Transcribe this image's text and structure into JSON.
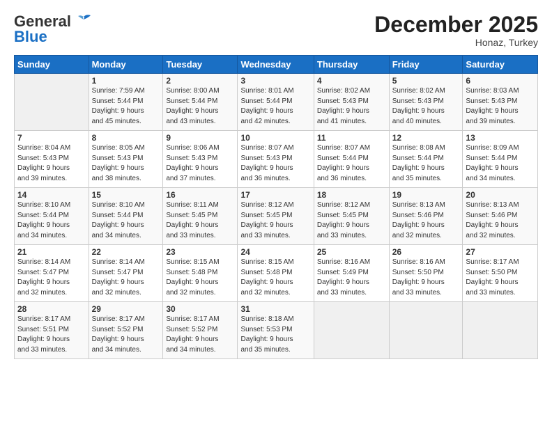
{
  "header": {
    "logo_general": "General",
    "logo_blue": "Blue",
    "month_title": "December 2025",
    "location": "Honaz, Turkey"
  },
  "weekdays": [
    "Sunday",
    "Monday",
    "Tuesday",
    "Wednesday",
    "Thursday",
    "Friday",
    "Saturday"
  ],
  "weeks": [
    [
      {
        "day": "",
        "info": ""
      },
      {
        "day": "1",
        "info": "Sunrise: 7:59 AM\nSunset: 5:44 PM\nDaylight: 9 hours\nand 45 minutes."
      },
      {
        "day": "2",
        "info": "Sunrise: 8:00 AM\nSunset: 5:44 PM\nDaylight: 9 hours\nand 43 minutes."
      },
      {
        "day": "3",
        "info": "Sunrise: 8:01 AM\nSunset: 5:44 PM\nDaylight: 9 hours\nand 42 minutes."
      },
      {
        "day": "4",
        "info": "Sunrise: 8:02 AM\nSunset: 5:43 PM\nDaylight: 9 hours\nand 41 minutes."
      },
      {
        "day": "5",
        "info": "Sunrise: 8:02 AM\nSunset: 5:43 PM\nDaylight: 9 hours\nand 40 minutes."
      },
      {
        "day": "6",
        "info": "Sunrise: 8:03 AM\nSunset: 5:43 PM\nDaylight: 9 hours\nand 39 minutes."
      }
    ],
    [
      {
        "day": "7",
        "info": "Sunrise: 8:04 AM\nSunset: 5:43 PM\nDaylight: 9 hours\nand 39 minutes."
      },
      {
        "day": "8",
        "info": "Sunrise: 8:05 AM\nSunset: 5:43 PM\nDaylight: 9 hours\nand 38 minutes."
      },
      {
        "day": "9",
        "info": "Sunrise: 8:06 AM\nSunset: 5:43 PM\nDaylight: 9 hours\nand 37 minutes."
      },
      {
        "day": "10",
        "info": "Sunrise: 8:07 AM\nSunset: 5:43 PM\nDaylight: 9 hours\nand 36 minutes."
      },
      {
        "day": "11",
        "info": "Sunrise: 8:07 AM\nSunset: 5:44 PM\nDaylight: 9 hours\nand 36 minutes."
      },
      {
        "day": "12",
        "info": "Sunrise: 8:08 AM\nSunset: 5:44 PM\nDaylight: 9 hours\nand 35 minutes."
      },
      {
        "day": "13",
        "info": "Sunrise: 8:09 AM\nSunset: 5:44 PM\nDaylight: 9 hours\nand 34 minutes."
      }
    ],
    [
      {
        "day": "14",
        "info": "Sunrise: 8:10 AM\nSunset: 5:44 PM\nDaylight: 9 hours\nand 34 minutes."
      },
      {
        "day": "15",
        "info": "Sunrise: 8:10 AM\nSunset: 5:44 PM\nDaylight: 9 hours\nand 34 minutes."
      },
      {
        "day": "16",
        "info": "Sunrise: 8:11 AM\nSunset: 5:45 PM\nDaylight: 9 hours\nand 33 minutes."
      },
      {
        "day": "17",
        "info": "Sunrise: 8:12 AM\nSunset: 5:45 PM\nDaylight: 9 hours\nand 33 minutes."
      },
      {
        "day": "18",
        "info": "Sunrise: 8:12 AM\nSunset: 5:45 PM\nDaylight: 9 hours\nand 33 minutes."
      },
      {
        "day": "19",
        "info": "Sunrise: 8:13 AM\nSunset: 5:46 PM\nDaylight: 9 hours\nand 32 minutes."
      },
      {
        "day": "20",
        "info": "Sunrise: 8:13 AM\nSunset: 5:46 PM\nDaylight: 9 hours\nand 32 minutes."
      }
    ],
    [
      {
        "day": "21",
        "info": "Sunrise: 8:14 AM\nSunset: 5:47 PM\nDaylight: 9 hours\nand 32 minutes."
      },
      {
        "day": "22",
        "info": "Sunrise: 8:14 AM\nSunset: 5:47 PM\nDaylight: 9 hours\nand 32 minutes."
      },
      {
        "day": "23",
        "info": "Sunrise: 8:15 AM\nSunset: 5:48 PM\nDaylight: 9 hours\nand 32 minutes."
      },
      {
        "day": "24",
        "info": "Sunrise: 8:15 AM\nSunset: 5:48 PM\nDaylight: 9 hours\nand 32 minutes."
      },
      {
        "day": "25",
        "info": "Sunrise: 8:16 AM\nSunset: 5:49 PM\nDaylight: 9 hours\nand 33 minutes."
      },
      {
        "day": "26",
        "info": "Sunrise: 8:16 AM\nSunset: 5:50 PM\nDaylight: 9 hours\nand 33 minutes."
      },
      {
        "day": "27",
        "info": "Sunrise: 8:17 AM\nSunset: 5:50 PM\nDaylight: 9 hours\nand 33 minutes."
      }
    ],
    [
      {
        "day": "28",
        "info": "Sunrise: 8:17 AM\nSunset: 5:51 PM\nDaylight: 9 hours\nand 33 minutes."
      },
      {
        "day": "29",
        "info": "Sunrise: 8:17 AM\nSunset: 5:52 PM\nDaylight: 9 hours\nand 34 minutes."
      },
      {
        "day": "30",
        "info": "Sunrise: 8:17 AM\nSunset: 5:52 PM\nDaylight: 9 hours\nand 34 minutes."
      },
      {
        "day": "31",
        "info": "Sunrise: 8:18 AM\nSunset: 5:53 PM\nDaylight: 9 hours\nand 35 minutes."
      },
      {
        "day": "",
        "info": ""
      },
      {
        "day": "",
        "info": ""
      },
      {
        "day": "",
        "info": ""
      }
    ]
  ]
}
